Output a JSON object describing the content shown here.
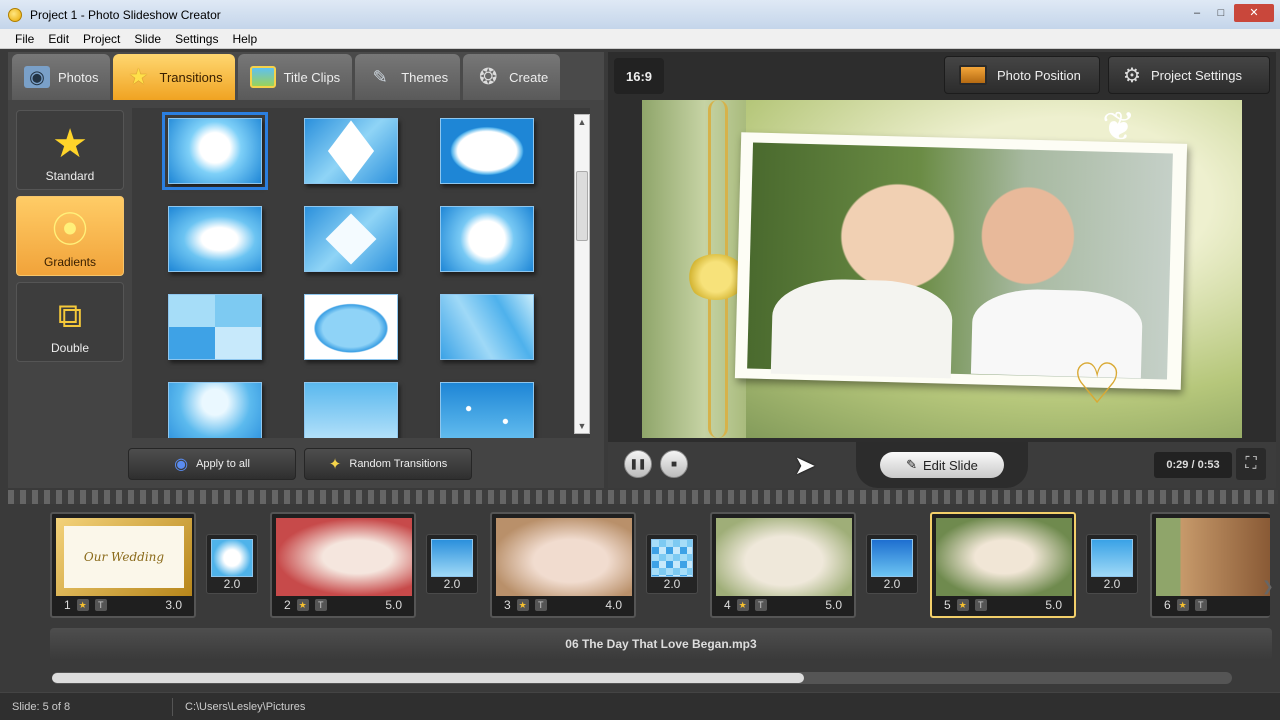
{
  "window": {
    "title": "Project 1 - Photo Slideshow Creator",
    "min": "–",
    "max": "□",
    "close": "✕"
  },
  "menu": [
    "File",
    "Edit",
    "Project",
    "Slide",
    "Settings",
    "Help"
  ],
  "tabs": [
    {
      "label": "Photos",
      "icon": "camera-icon"
    },
    {
      "label": "Transitions",
      "icon": "star-icon",
      "active": true
    },
    {
      "label": "Title Clips",
      "icon": "picture-icon"
    },
    {
      "label": "Themes",
      "icon": "brush-icon"
    },
    {
      "label": "Create",
      "icon": "film-reel-icon"
    }
  ],
  "categories": [
    {
      "label": "Standard",
      "icon": "star-icon"
    },
    {
      "label": "Gradients",
      "icon": "gradient-icon",
      "active": true
    },
    {
      "label": "Double",
      "icon": "double-icon"
    }
  ],
  "actions": {
    "apply_all": "Apply to all",
    "random": "Random Transitions"
  },
  "preview": {
    "ratio": "16:9",
    "photo_position": "Photo Position",
    "project_settings": "Project Settings",
    "edit_slide": "Edit Slide",
    "time": "0:29 / 0:53"
  },
  "timeline": {
    "slides": [
      {
        "num": "1",
        "dur": "3.0",
        "overlay": "Our Wedding",
        "colors": [
          "#f3d27a",
          "#b7861b"
        ]
      },
      {
        "num": "2",
        "dur": "5.0",
        "colors": [
          "#e8d0c8",
          "#c74a4a"
        ]
      },
      {
        "num": "3",
        "dur": "4.0",
        "colors": [
          "#f1dccf",
          "#b9906a"
        ]
      },
      {
        "num": "4",
        "dur": "5.0",
        "colors": [
          "#efe8da",
          "#9fae78"
        ]
      },
      {
        "num": "5",
        "dur": "5.0",
        "selected": true,
        "colors": [
          "#dfe6c8",
          "#6f8a4e"
        ]
      },
      {
        "num": "6",
        "dur": "",
        "colors": [
          "#c79a6b",
          "#7a4a28"
        ]
      }
    ],
    "transitions": [
      "2.0",
      "2.0",
      "2.0",
      "2.0",
      "2.0"
    ],
    "audio": "06 The Day That Love Began.mp3"
  },
  "status": {
    "slide": "Slide: 5 of 8",
    "path": "C:\\Users\\Lesley\\Pictures"
  },
  "colors": {
    "accent": "#f1a33a",
    "selection_blue": "#2b7fe0",
    "transition_blue": "#4fb3ea"
  }
}
